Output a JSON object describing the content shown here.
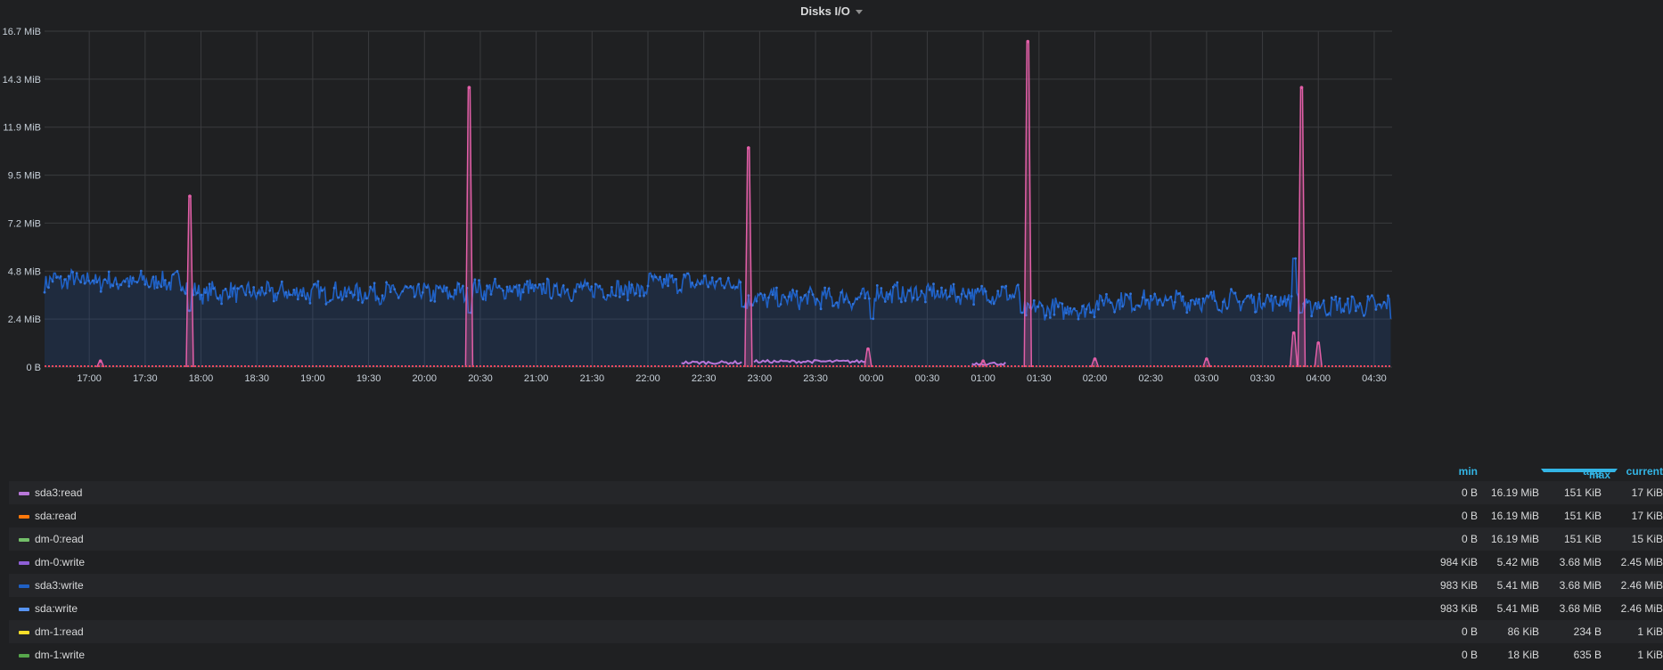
{
  "panel": {
    "title": "Disks I/O"
  },
  "chart_data": {
    "type": "area",
    "title": "Disks I/O",
    "y_unit": "MiB",
    "ylim": [
      0,
      16.7
    ],
    "y_ticks": [
      "0 B",
      "2.4 MiB",
      "4.8 MiB",
      "7.2 MiB",
      "9.5 MiB",
      "11.9 MiB",
      "14.3 MiB",
      "16.7 MiB"
    ],
    "x_ticks": [
      "17:00",
      "17:30",
      "18:00",
      "18:30",
      "19:00",
      "19:30",
      "20:00",
      "20:30",
      "21:00",
      "21:30",
      "22:00",
      "22:30",
      "23:00",
      "23:30",
      "00:00",
      "00:30",
      "01:00",
      "01:30",
      "02:00",
      "02:30",
      "03:00",
      "03:30",
      "04:00",
      "04:30"
    ],
    "x_range_hours": [
      16.6,
      28.66
    ],
    "grid": true,
    "series": [
      {
        "name": "sda3:write",
        "color": "#1f60c4",
        "fill": true,
        "segments": [
          {
            "from": 16.6,
            "to": 17.08,
            "level": 4.3
          },
          {
            "from": 17.08,
            "to": 17.9,
            "level": 4.25
          },
          {
            "from": 17.9,
            "to": 20.4,
            "level": 3.7
          },
          {
            "from": 20.4,
            "to": 22.0,
            "level": 3.85
          },
          {
            "from": 22.0,
            "to": 22.85,
            "level": 4.2
          },
          {
            "from": 22.85,
            "to": 24.0,
            "level": 3.4
          },
          {
            "from": 24.0,
            "to": 25.35,
            "level": 3.65
          },
          {
            "from": 25.35,
            "to": 26.0,
            "level": 2.9
          },
          {
            "from": 26.0,
            "to": 27.85,
            "level": 3.3
          },
          {
            "from": 27.85,
            "to": 28.66,
            "level": 3.05
          }
        ],
        "dips": [
          {
            "x": 17.9,
            "value": 2.8
          },
          {
            "x": 20.4,
            "value": 2.7
          },
          {
            "x": 22.85,
            "value": 3.0
          },
          {
            "x": 24.0,
            "value": 2.4
          },
          {
            "x": 25.35,
            "value": 2.7
          },
          {
            "x": 27.78,
            "value": 5.4
          },
          {
            "x": 27.85,
            "value": 2.7
          },
          {
            "x": 28.66,
            "value": 2.4
          }
        ]
      },
      {
        "name": "sda3:read",
        "color": "#b877d9",
        "line_color": "#e25fa8",
        "peaks": [
          {
            "x": 17.9,
            "value": 8.5
          },
          {
            "x": 20.4,
            "value": 13.9
          },
          {
            "x": 22.9,
            "value": 10.9
          },
          {
            "x": 25.4,
            "value": 16.19
          },
          {
            "x": 27.85,
            "value": 13.9
          },
          {
            "x": 27.78,
            "value": 1.7
          },
          {
            "x": 28.0,
            "value": 1.2
          },
          {
            "x": 23.97,
            "value": 0.9
          },
          {
            "x": 17.1,
            "value": 0.3
          },
          {
            "x": 26.0,
            "value": 0.4
          },
          {
            "x": 27.0,
            "value": 0.4
          },
          {
            "x": 25.0,
            "value": 0.3
          }
        ],
        "low_band": [
          {
            "from": 22.3,
            "to": 22.85,
            "value": 0.15
          },
          {
            "from": 22.95,
            "to": 23.95,
            "value": 0.2
          },
          {
            "from": 24.9,
            "to": 25.2,
            "value": 0.1
          }
        ]
      },
      {
        "name": "dm-1:read",
        "color": "#f2495c",
        "baseline": 0.0
      }
    ]
  },
  "legend": {
    "headers": {
      "min": "min",
      "max": "max",
      "avg": "avg",
      "current": "current"
    },
    "rows": [
      {
        "name": "sda3:read",
        "color": "#b877d9",
        "min": "0 B",
        "max": "16.19 MiB",
        "avg": "151 KiB",
        "current": "17 KiB"
      },
      {
        "name": "sda:read",
        "color": "#ff780a",
        "min": "0 B",
        "max": "16.19 MiB",
        "avg": "151 KiB",
        "current": "17 KiB"
      },
      {
        "name": "dm-0:read",
        "color": "#73bf69",
        "min": "0 B",
        "max": "16.19 MiB",
        "avg": "151 KiB",
        "current": "15 KiB"
      },
      {
        "name": "dm-0:write",
        "color": "#8f5fd7",
        "min": "984 KiB",
        "max": "5.42 MiB",
        "avg": "3.68 MiB",
        "current": "2.45 MiB"
      },
      {
        "name": "sda3:write",
        "color": "#1f60c4",
        "min": "983 KiB",
        "max": "5.41 MiB",
        "avg": "3.68 MiB",
        "current": "2.46 MiB"
      },
      {
        "name": "sda:write",
        "color": "#5794f2",
        "min": "983 KiB",
        "max": "5.41 MiB",
        "avg": "3.68 MiB",
        "current": "2.46 MiB"
      },
      {
        "name": "dm-1:read",
        "color": "#fade2a",
        "min": "0 B",
        "max": "86 KiB",
        "avg": "234 B",
        "current": "1 KiB"
      },
      {
        "name": "dm-1:write",
        "color": "#56a64b",
        "min": "0 B",
        "max": "18 KiB",
        "avg": "635 B",
        "current": "1 KiB"
      }
    ]
  }
}
